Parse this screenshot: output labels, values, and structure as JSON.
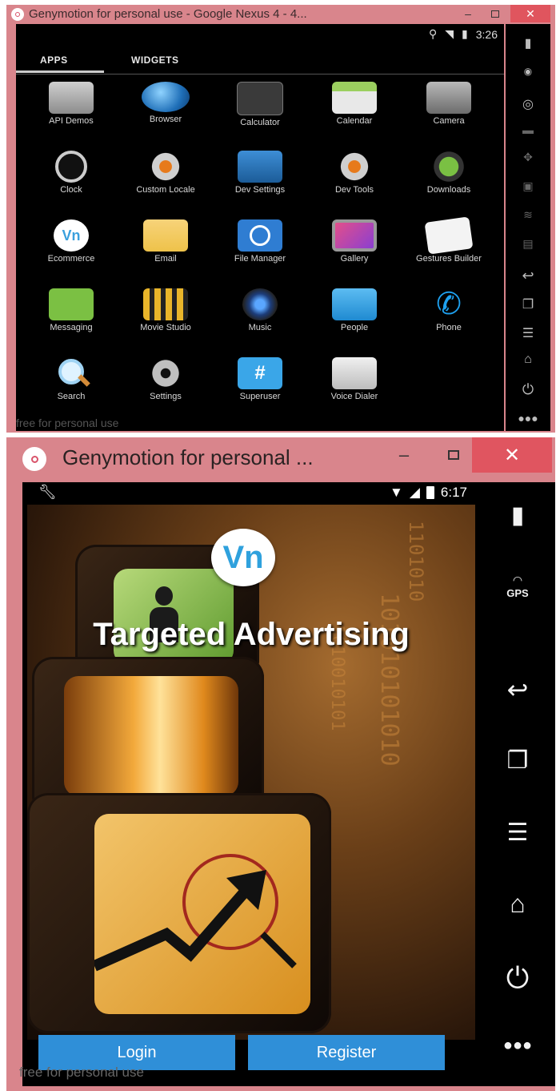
{
  "window1": {
    "title": "Genymotion for personal use - Google Nexus 4 - 4...",
    "controls": {
      "minimize": "–",
      "close": "✕"
    },
    "status": {
      "time": "3:26"
    },
    "tabs": [
      {
        "label": "APPS"
      },
      {
        "label": "WIDGETS"
      }
    ],
    "apps": [
      {
        "label": "API Demos",
        "icon": "folder-icon"
      },
      {
        "label": "Browser",
        "icon": "globe-icon"
      },
      {
        "label": "Calculator",
        "icon": "calculator-icon"
      },
      {
        "label": "Calendar",
        "icon": "calendar-icon"
      },
      {
        "label": "Camera",
        "icon": "camera-icon"
      },
      {
        "label": "Clock",
        "icon": "clock-icon"
      },
      {
        "label": "Custom Locale",
        "icon": "gear-icon"
      },
      {
        "label": "Dev Settings",
        "icon": "dev-settings-icon"
      },
      {
        "label": "Dev Tools",
        "icon": "gear-icon"
      },
      {
        "label": "Downloads",
        "icon": "download-icon"
      },
      {
        "label": "Ecommerce",
        "icon": "vn-icon"
      },
      {
        "label": "Email",
        "icon": "email-icon"
      },
      {
        "label": "File Manager",
        "icon": "file-manager-icon"
      },
      {
        "label": "Gallery",
        "icon": "gallery-icon"
      },
      {
        "label": "Gestures Builder",
        "icon": "gestures-icon"
      },
      {
        "label": "Messaging",
        "icon": "messaging-icon"
      },
      {
        "label": "Movie Studio",
        "icon": "movie-icon"
      },
      {
        "label": "Music",
        "icon": "music-icon"
      },
      {
        "label": "People",
        "icon": "people-icon"
      },
      {
        "label": "Phone",
        "icon": "phone-icon"
      },
      {
        "label": "Search",
        "icon": "search-icon"
      },
      {
        "label": "Settings",
        "icon": "settings-icon"
      },
      {
        "label": "Superuser",
        "icon": "superuser-icon"
      },
      {
        "label": "Voice Dialer",
        "icon": "voice-dialer-icon"
      }
    ],
    "vn_text": "Vn",
    "superuser_glyph": "#",
    "phone_glyph": "✆",
    "watermark": "free for personal use"
  },
  "window2": {
    "title": "Genymotion for personal ...",
    "controls": {
      "minimize": "–",
      "close": "✕"
    },
    "status": {
      "time": "6:17"
    },
    "badge": "Vn",
    "app_title": "Targeted Advertising",
    "binary": [
      "1101010",
      "101010101010",
      "1010010101",
      "10101001010"
    ],
    "buttons": {
      "login": "Login",
      "register": "Register"
    },
    "side_gps": "GPS",
    "watermark": "free for personal use"
  },
  "colors": {
    "window_border": "#d9858c",
    "close_button": "#e05560",
    "button_blue": "#2f8fd8"
  }
}
